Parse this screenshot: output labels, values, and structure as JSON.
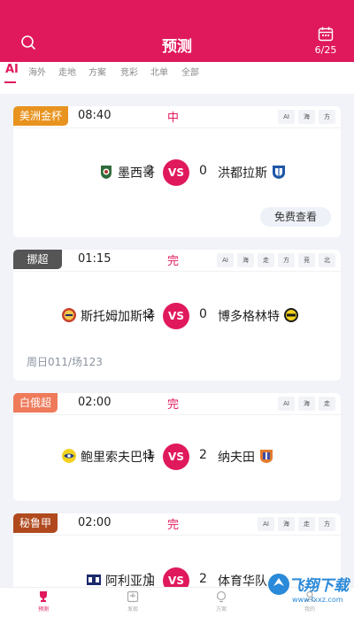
{
  "header": {
    "title": "预测",
    "calendar_date": "6/25"
  },
  "tabs": [
    "AI",
    "海外",
    "走地",
    "方案",
    "竞彩",
    "北单",
    "全部"
  ],
  "matches": [
    {
      "league": "美洲金杯",
      "league_color": "#e8931f",
      "time": "08:40",
      "status": "中",
      "tags": [
        "AI",
        "海",
        "方"
      ],
      "home": "墨西哥",
      "home_score": "2",
      "away": "洪都拉斯",
      "away_score": "0",
      "vs": "VS",
      "button": "免费查看"
    },
    {
      "league": "挪超",
      "league_color": "#555555",
      "time": "01:15",
      "status": "完",
      "tags": [
        "AI",
        "海",
        "走",
        "方",
        "竞",
        "北"
      ],
      "home": "斯托姆加斯特",
      "home_score": "2",
      "away": "博多格林特",
      "away_score": "0",
      "vs": "VS",
      "note": "周日011/场123"
    },
    {
      "league": "白俄超",
      "league_color": "#ee7a5a",
      "time": "02:00",
      "status": "完",
      "tags": [
        "AI",
        "海",
        "走"
      ],
      "home": "鲍里索夫巴特",
      "home_score": "1",
      "away": "纳夫田",
      "away_score": "2",
      "vs": "VS"
    },
    {
      "league": "秘鲁甲",
      "league_color": "#b04a1e",
      "time": "02:00",
      "status": "完",
      "tags": [
        "AI",
        "海",
        "走",
        "方"
      ],
      "home": "阿利亚加",
      "home_score": "1",
      "away": "体育华队",
      "away_score": "2",
      "vs": "VS"
    }
  ],
  "bottom_nav": [
    "预测",
    "发现",
    "方案",
    "我的"
  ],
  "watermark": {
    "text": "飞翔下载",
    "sub": "www.fxxz.com"
  }
}
